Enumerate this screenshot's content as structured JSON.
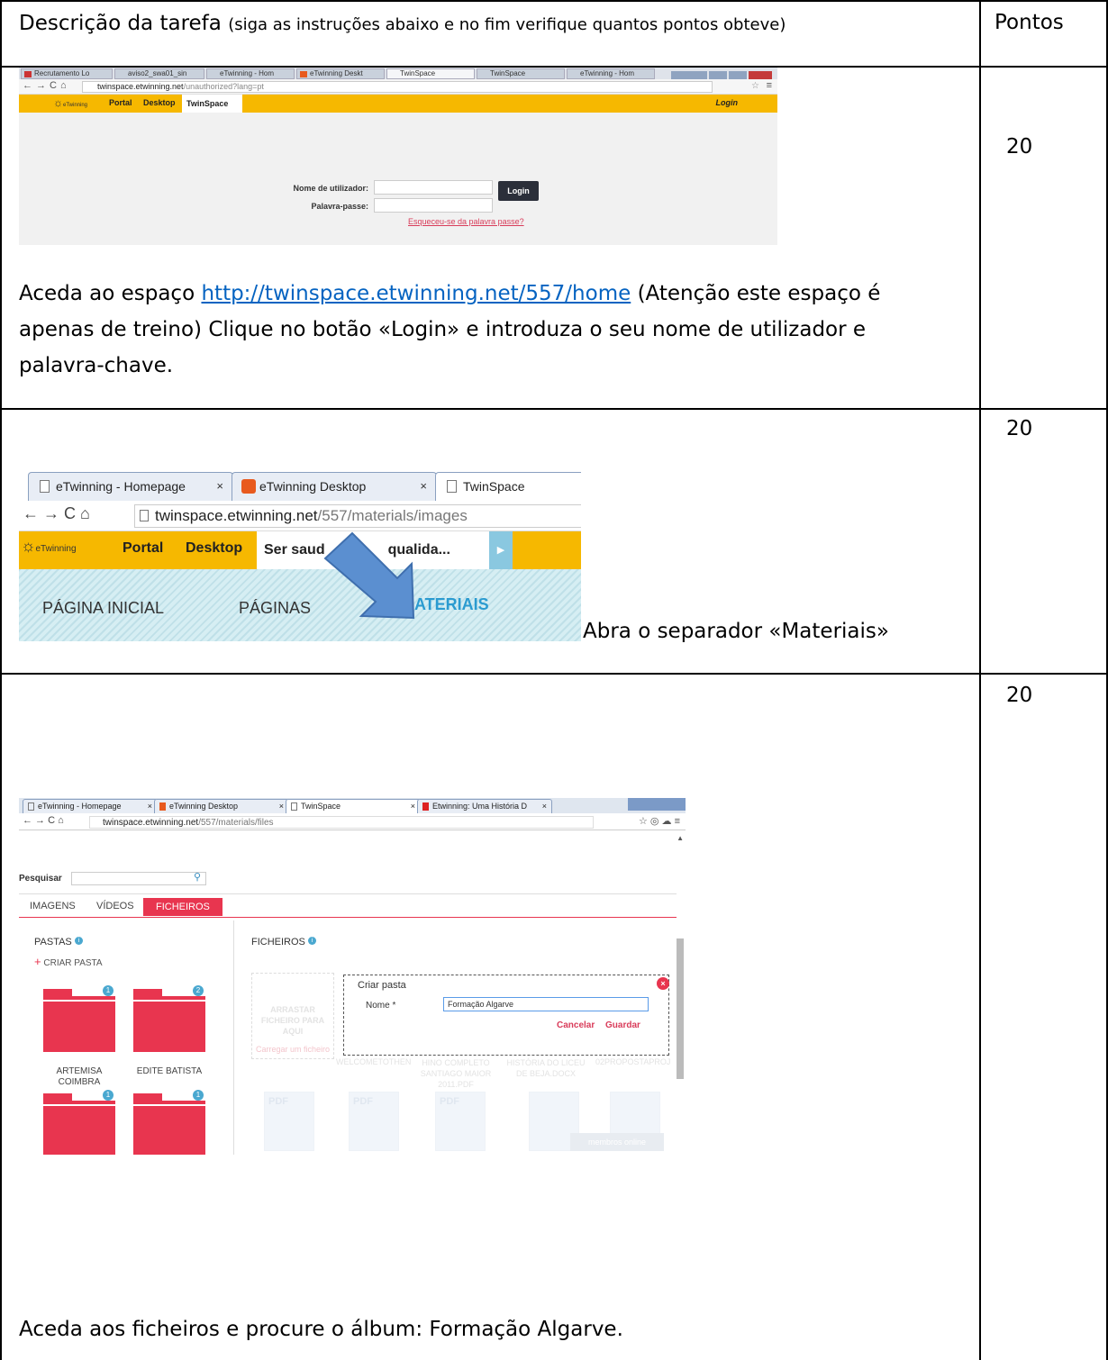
{
  "table": {
    "header_task": "Descrição da tarefa",
    "header_task_note": "(siga as instruções abaixo e no fim verifique quantos pontos obteve)",
    "header_points": "Pontos"
  },
  "rows": [
    {
      "points": "20",
      "text_before_link": "Aceda ao espaço",
      "link": "http://twinspace.etwinning.net/557/home",
      "text_after_link_1": " (Atenção este espaço é",
      "text_line_2": "apenas de treino) Clique no botão «Login» e introduza o seu nome de utilizador e",
      "text_line_3": "palavra-chave."
    },
    {
      "points": "20",
      "caption": "Abra o separador «Materiais»"
    },
    {
      "points": "20",
      "caption": "Aceda aos ficheiros e procure o álbum: Formação Algarve."
    }
  ],
  "shot1": {
    "tabs": [
      "Recrutamento Lo",
      "aviso2_swa01_sin",
      "eTwinning - Hom",
      "eTwinning Deskt",
      "TwinSpace",
      "TwinSpace",
      "eTwinning - Hom"
    ],
    "url_host": "twinspace.etwinning.net",
    "url_path": "/unauthorized?lang=pt",
    "logo": "eTwinning",
    "nav_portal": "Portal",
    "nav_desktop": "Desktop",
    "nav_twinspace": "TwinSpace",
    "login_link": "Login",
    "username_label": "Nome de utilizador:",
    "password_label": "Palavra-passe:",
    "login_button": "Login",
    "forgot_link": "Esqueceu-se da palavra passe?"
  },
  "shot2": {
    "tabs": [
      "eTwinning - Homepage",
      "eTwinning Desktop",
      "TwinSpace"
    ],
    "url_host": "twinspace.etwinning.net",
    "url_path": "/557/materials/images",
    "logo": "eTwinning",
    "nav_portal": "Portal",
    "nav_desktop": "Desktop",
    "project_title": "Ser saud",
    "project_title_rest": "qualida...",
    "menu_home": "PÁGINA INICIAL",
    "menu_pages": "PÁGINAS",
    "menu_materials": "MATERIAIS"
  },
  "shot3": {
    "tabs": [
      "eTwinning - Homepage",
      "eTwinning Desktop",
      "TwinSpace",
      "Etwinning: Uma História D"
    ],
    "url_host": "twinspace.etwinning.net",
    "url_path": "/557/materials/files",
    "search_label": "Pesquisar",
    "tab_images": "IMAGENS",
    "tab_videos": "VÍDEOS",
    "tab_files": "FICHEIROS",
    "folders_heading": "PASTAS",
    "files_heading": "FICHEIROS",
    "create_folder": "CRIAR PASTA",
    "folders": [
      {
        "name": "ARTEMISA COIMBRA",
        "count": "1"
      },
      {
        "name": "EDITE BATISTA",
        "count": "2"
      },
      {
        "name": "",
        "count": "1"
      },
      {
        "name": "",
        "count": "1"
      }
    ],
    "drop_text": "ARRASTAR FICHEIRO PARA AQUI",
    "drop_sub": "Carregar um ficheiro",
    "ghost_files": [
      "WELCOMETOTHEN",
      "HINO COMPLETO SANTIAGO MAIOR 2011.PDF",
      "HISTÓRIA DO LICEU DE BEJA.DOCX",
      "02PROPOSTAPROJ"
    ],
    "dialog_title": "Criar pasta",
    "dialog_name_label": "Nome *",
    "dialog_name_value": "Formação Algarve",
    "dialog_cancel": "Cancelar",
    "dialog_save": "Guardar",
    "online_badge": "membros online"
  }
}
